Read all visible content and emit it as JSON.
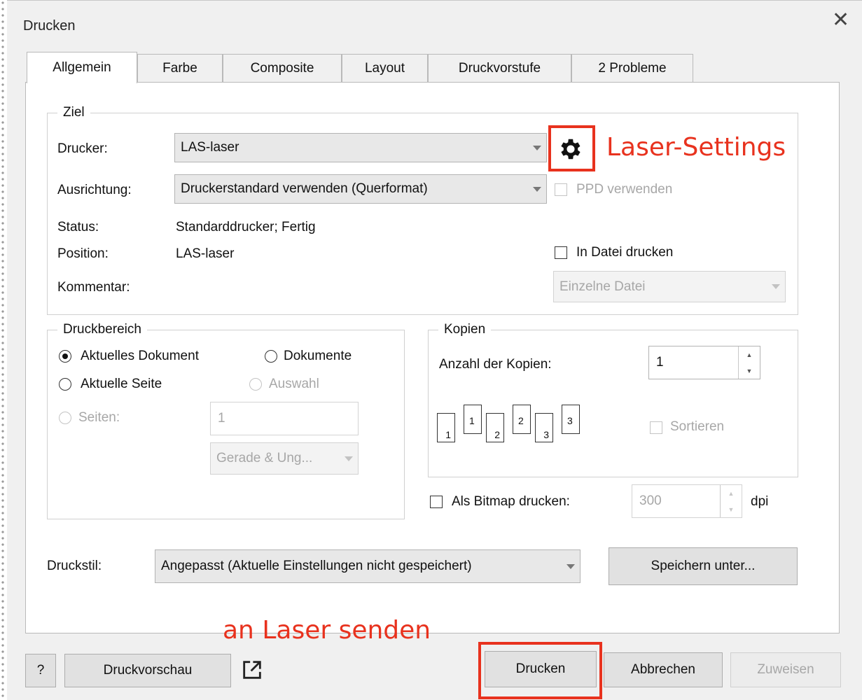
{
  "window": {
    "title": "Drucken"
  },
  "tabs": [
    {
      "label": "Allgemein",
      "active": true
    },
    {
      "label": "Farbe"
    },
    {
      "label": "Composite"
    },
    {
      "label": "Layout"
    },
    {
      "label": "Druckvorstufe"
    },
    {
      "label": "2 Probleme"
    }
  ],
  "ziel": {
    "legend": "Ziel",
    "drucker_label": "Drucker:",
    "drucker_value": "LAS-laser",
    "ausrichtung_label": "Ausrichtung:",
    "ausrichtung_value": "Druckerstandard verwenden (Querformat)",
    "ppd_label": "PPD verwenden",
    "status_label": "Status:",
    "status_value": "Standarddrucker; Fertig",
    "position_label": "Position:",
    "position_value": "LAS-laser",
    "in_datei_label": "In Datei drucken",
    "kommentar_label": "Kommentar:",
    "einzelne_datei": "Einzelne Datei"
  },
  "druckbereich": {
    "legend": "Druckbereich",
    "aktuelles_dokument": "Aktuelles Dokument",
    "dokumente": "Dokumente",
    "aktuelle_seite": "Aktuelle Seite",
    "auswahl": "Auswahl",
    "seiten": "Seiten:",
    "seiten_value": "1",
    "gerade_ungerade": "Gerade & Ung..."
  },
  "kopien": {
    "legend": "Kopien",
    "anzahl_label": "Anzahl der Kopien:",
    "anzahl_value": "1",
    "sortieren": "Sortieren",
    "pages": [
      "1",
      "2",
      "3"
    ]
  },
  "bitmap": {
    "label": "Als Bitmap drucken:",
    "value": "300",
    "unit": "dpi"
  },
  "druckstil": {
    "label": "Druckstil:",
    "value": "Angepasst (Aktuelle Einstellungen nicht gespeichert)",
    "speichern": "Speichern unter..."
  },
  "footer": {
    "help": "?",
    "druckvorschau": "Druckvorschau",
    "drucken": "Drucken",
    "abbrechen": "Abbrechen",
    "zuweisen": "Zuweisen"
  },
  "annotations": {
    "laser_settings": "Laser-Settings",
    "an_laser_senden": "an Laser senden",
    "color": "#e8321e"
  },
  "icons": [
    "gear-icon",
    "external-link-icon",
    "close-icon",
    "copies-icon"
  ]
}
